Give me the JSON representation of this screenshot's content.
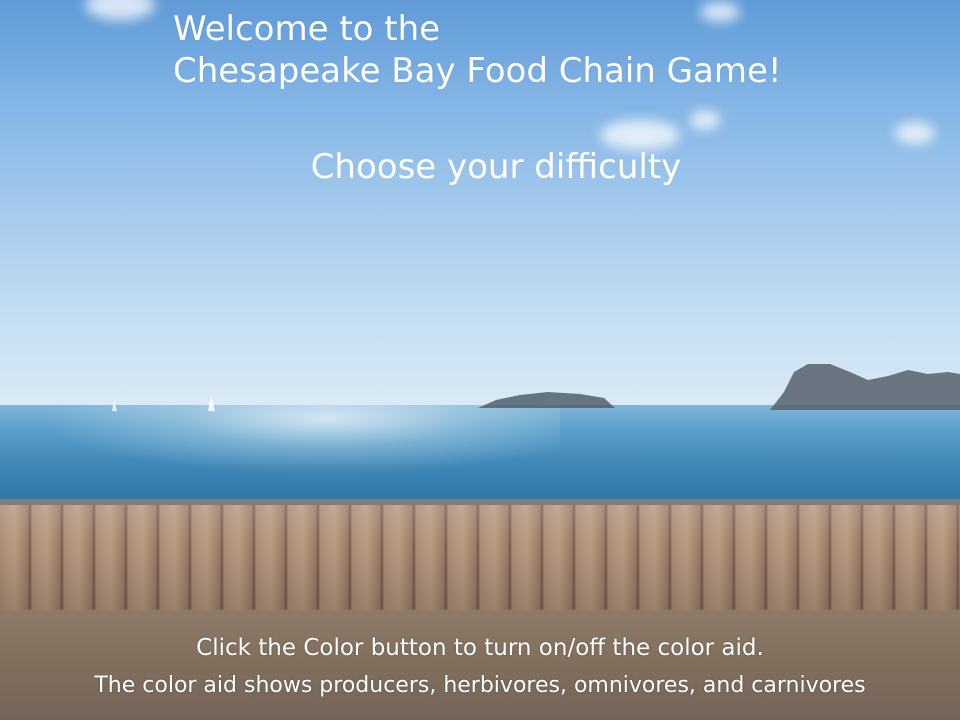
{
  "game": {
    "title_line1": "Welcome to the",
    "title_line2": "Chesapeake Bay Food Chain Game!",
    "subtitle": "Choose your difficulty",
    "instruction_line1": "Click the Color button to turn on/off the color aid.",
    "instruction_line2": "The color aid shows producers,  herbivores, omnivores, and carnivores"
  }
}
